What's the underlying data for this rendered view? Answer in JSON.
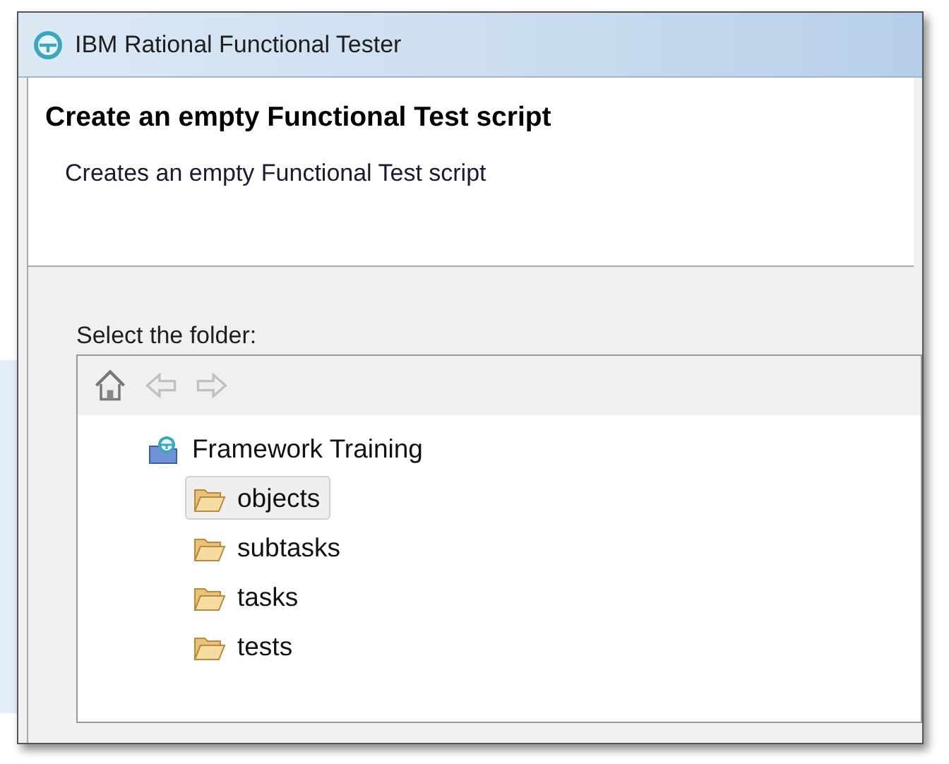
{
  "window": {
    "title": "IBM Rational Functional Tester"
  },
  "header": {
    "title": "Create an empty Functional Test script",
    "description": "Creates an empty Functional Test script"
  },
  "folder_label": "Select the folder:",
  "toolbar": [
    {
      "kind": "home",
      "disabled": false
    },
    {
      "kind": "back",
      "disabled": true
    },
    {
      "kind": "forward",
      "disabled": true
    }
  ],
  "tree": [
    {
      "label": "Framework Training",
      "kind": "project",
      "selected": false,
      "children": [
        {
          "label": "objects",
          "kind": "folder",
          "selected": true
        },
        {
          "label": "subtasks",
          "kind": "folder",
          "selected": false
        },
        {
          "label": "tasks",
          "kind": "folder",
          "selected": false
        },
        {
          "label": "tests",
          "kind": "folder",
          "selected": false
        }
      ]
    }
  ]
}
